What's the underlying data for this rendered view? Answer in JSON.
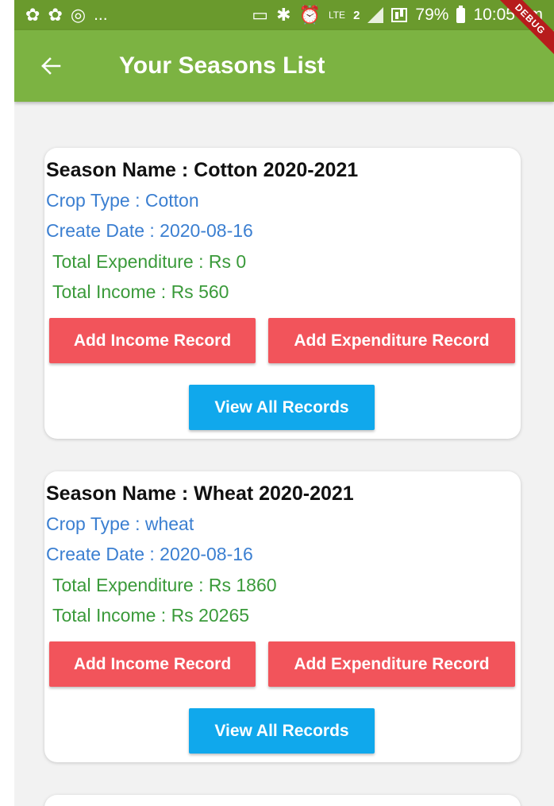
{
  "status_bar": {
    "left_icons": [
      "app-notification-icon",
      "app-notification-icon",
      "instagram-icon"
    ],
    "overflow": "...",
    "lte_label": "LTE",
    "sim_label": "2",
    "battery": "79%",
    "time": "10:05 am"
  },
  "debug_banner": "DEBUG",
  "app_bar": {
    "title": "Your Seasons List",
    "back_icon": "arrow-left-icon"
  },
  "seasons": [
    {
      "name": "Season Name : Cotton 2020-2021",
      "crop_type": "Crop Type : Cotton",
      "create_date": "Create Date : 2020-08-16",
      "total_expenditure": " Total Expenditure : Rs 0",
      "total_income": " Total Income : Rs 560",
      "add_income_label": "Add Income Record",
      "add_expenditure_label": "Add Expenditure Record",
      "view_all_label": "View All Records"
    },
    {
      "name": "Season Name : Wheat 2020-2021",
      "crop_type": "Crop Type : wheat",
      "create_date": "Create Date : 2020-08-16",
      "total_expenditure": " Total Expenditure : Rs 1860",
      "total_income": " Total Income : Rs 20265",
      "add_income_label": "Add Income Record",
      "add_expenditure_label": "Add Expenditure Record",
      "view_all_label": "View All Records"
    }
  ],
  "colors": {
    "app_bar": "#7cb342",
    "status_bar": "#6a9a2d",
    "info_blue": "#3b7fd1",
    "total_green": "#3a9a3a",
    "button_red": "#f2545b",
    "button_blue": "#10a8ec"
  }
}
